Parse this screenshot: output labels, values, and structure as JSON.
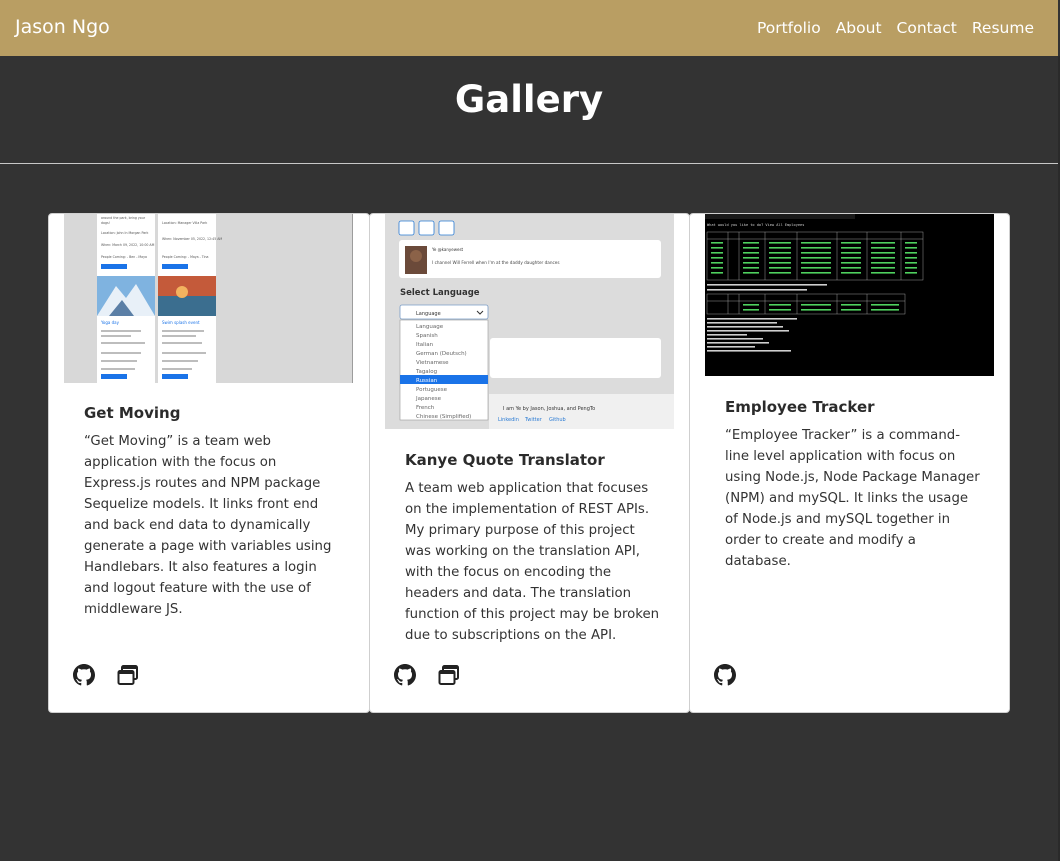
{
  "brand": "Jason Ngo",
  "nav": [
    "Portfolio",
    "About",
    "Contact",
    "Resume"
  ],
  "page_title": "Gallery",
  "cards": [
    {
      "title": "Get Moving",
      "description": "“Get Moving” is a team web application with the focus on Express.js routes and NPM package Sequelize models. It links front end and back end data to dynamically generate a page with variables using Handlebars. It also features a login and logout feature with the use of middleware JS.",
      "icons": [
        "github-icon",
        "window-icon"
      ],
      "screenshot": {
        "left_top": [
          "around the park, bring your",
          "dogs!",
          "Location: John In Morgan Park",
          "When: March 09, 2022, 10:00 AM",
          "People Coming: - Ben - Maya"
        ],
        "right_top": [
          "Location: Manager Villa Park",
          "When: November 05, 2022, 12:45 AM",
          "People Coming: - Maya - Tina"
        ],
        "event_left": "Yoga day",
        "event_right": "Swim splash event",
        "button": "Click to Attend"
      }
    },
    {
      "title": "Kanye Quote Translator",
      "description": "A team web application that focuses on the implementation of REST APIs. My primary purpose of this project was working on the translation API, with the focus on encoding the headers and data. The translation function of this project may be broken due to subscriptions on the API.",
      "icons": [
        "github-icon",
        "window-icon"
      ],
      "screenshot": {
        "quote": "I channel Will Ferrell when I'm at the daddy daughter dances",
        "select_label": "Select Language",
        "select_value": "Language",
        "options": [
          "Language",
          "Spanish",
          "Italian",
          "German (Deutsch)",
          "Vietnamese",
          "Tagalog",
          "Russian",
          "Portuguese",
          "Japanese",
          "French",
          "Chinese (Simplified)"
        ],
        "selected_option": "Russian",
        "footer": [
          "Linkedin",
          "Twitter",
          "Github"
        ]
      }
    },
    {
      "title": "Employee Tracker",
      "description": "“Employee Tracker” is a command-line level application with focus on using Node.js, Node Package Manager (NPM) and mySQL. It links the usage of Node.js and mySQL together in order to create and modify a database.",
      "icons": [
        "github-icon"
      ],
      "screenshot": {
        "prompt": "What would you like to do? View All Employees"
      }
    }
  ],
  "colors": {
    "navbar": "#b99e63",
    "background": "#333333",
    "card": "#ffffff"
  }
}
